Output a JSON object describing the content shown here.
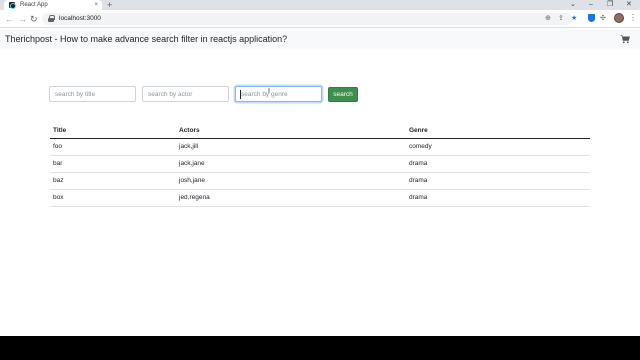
{
  "browser": {
    "tab_title": "React App",
    "tab_close": "×",
    "new_tab": "+",
    "window_controls": [
      "⌄",
      "–",
      "❐",
      "✕"
    ],
    "url": "localhost:3000"
  },
  "navbar": {
    "brand": "Therichpost - How to make advance search filter in reactjs application?",
    "cart_icon": "shopping-cart-icon"
  },
  "search": {
    "title_placeholder": "search by title",
    "actor_placeholder": "search by actor",
    "genre_placeholder": "search by genre",
    "button_label": "search",
    "button_color": "#3e8e4d"
  },
  "table": {
    "headers": [
      "Title",
      "Actors",
      "Genre"
    ],
    "rows": [
      [
        "foo",
        "jack,jill",
        "comedy"
      ],
      [
        "bar",
        "jack,jane",
        "drama"
      ],
      [
        "baz",
        "josh,jane",
        "drama"
      ],
      [
        "box",
        "jed,regena",
        "drama"
      ]
    ]
  }
}
